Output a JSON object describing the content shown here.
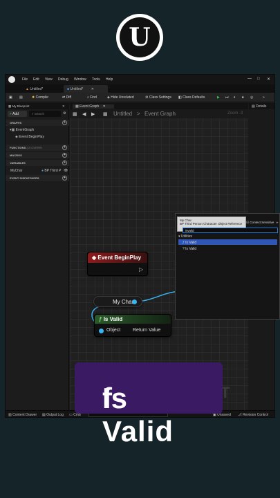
{
  "menu": [
    "File",
    "Edit",
    "View",
    "Debug",
    "Window",
    "Tools",
    "Help"
  ],
  "tabs": {
    "first": "Untitled*",
    "second": "Untitled*"
  },
  "toolbar": {
    "compile": "Compile",
    "diff": "Diff",
    "find": "Find",
    "hide_unrelated": "Hide Unrelated",
    "class_settings": "Class Settings",
    "class_defaults": "Class Defaults"
  },
  "my_blueprint": {
    "tab": "My Blueprint",
    "add": "Add",
    "search_placeholder": "Search",
    "graphs": "GRAPHS",
    "event_graph": "EventGraph",
    "event_begin_play": "Event BeginPlay",
    "functions": "FUNCTIONS",
    "functions_count": "(15 OVERRI",
    "macros": "MACROS",
    "variables": "VARIABLES",
    "var_name": "MyChar",
    "var_type": "BP Third P",
    "dispatchers": "EVENT DISPATCHERS"
  },
  "graph": {
    "tab": "Event Graph",
    "breadcrumb_root": "Untitled",
    "breadcrumb_sep": ">",
    "breadcrumb_leaf": "Event Graph",
    "zoom": "Zoom -3",
    "watermark": "INT",
    "begin_play": "Event BeginPlay",
    "var_node": "My Char",
    "is_valid": "Is Valid",
    "object_pin": "Object",
    "return_pin": "Return Value"
  },
  "details_tab": "Details",
  "context_menu": {
    "tooltip_title": "My Char",
    "tooltip_sub": "BP Third Person Character Object Reference",
    "context_sensitive": "Context Sensitive",
    "search_value": "isvalid",
    "category": "Utilities",
    "items": [
      "Is Valid",
      "Is Valid"
    ]
  },
  "statusbar": {
    "content_drawer": "Content Drawer",
    "output_log": "Output Log",
    "cmd": "Cmd",
    "unsaved": "Unsaved",
    "revision": "Revision Control"
  },
  "caption": {
    "icon": "f",
    "text": "Is Valid"
  }
}
